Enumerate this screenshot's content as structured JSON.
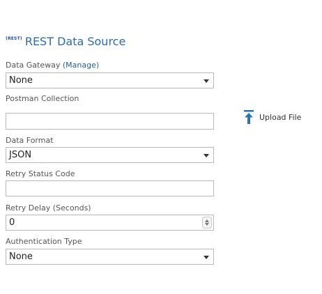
{
  "header": {
    "badge": "(REST)",
    "title": "REST Data Source"
  },
  "data_gateway": {
    "label": "Data Gateway",
    "manage_link": "(Manage)",
    "value": "None"
  },
  "postman_collection": {
    "label": "Postman Collection",
    "value": ""
  },
  "upload": {
    "label": "Upload File",
    "icon": "upload-icon"
  },
  "data_format": {
    "label": "Data Format",
    "value": "JSON"
  },
  "retry_status_code": {
    "label": "Retry Status Code",
    "value": ""
  },
  "retry_delay": {
    "label": "Retry Delay (Seconds)",
    "value": "0"
  },
  "authentication_type": {
    "label": "Authentication Type",
    "value": "None"
  },
  "colors": {
    "title": "#2b6cb0",
    "link": "#1f5f99",
    "upload_icon": "#2e72b8"
  }
}
